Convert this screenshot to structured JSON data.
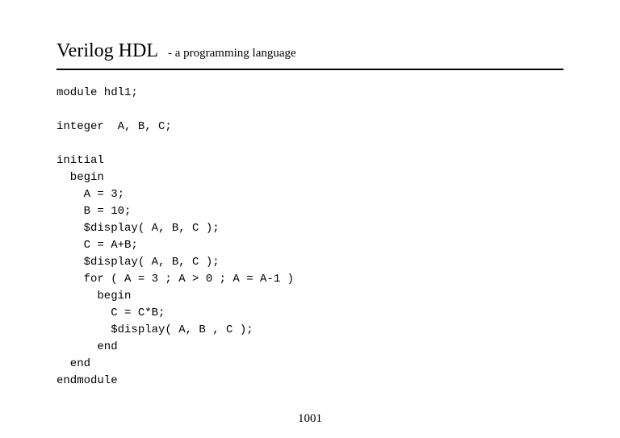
{
  "header": {
    "title": "Verilog HDL",
    "subtitle": "- a programming language"
  },
  "code": "module hdl1;\n\ninteger  A, B, C;\n\ninitial\n  begin\n    A = 3;\n    B = 10;\n    $display( A, B, C );\n    C = A+B;\n    $display( A, B, C );\n    for ( A = 3 ; A > 0 ; A = A-1 )\n      begin\n        C = C*B;\n        $display( A, B , C );\n      end\n  end\nendmodule",
  "page_number": "1001"
}
